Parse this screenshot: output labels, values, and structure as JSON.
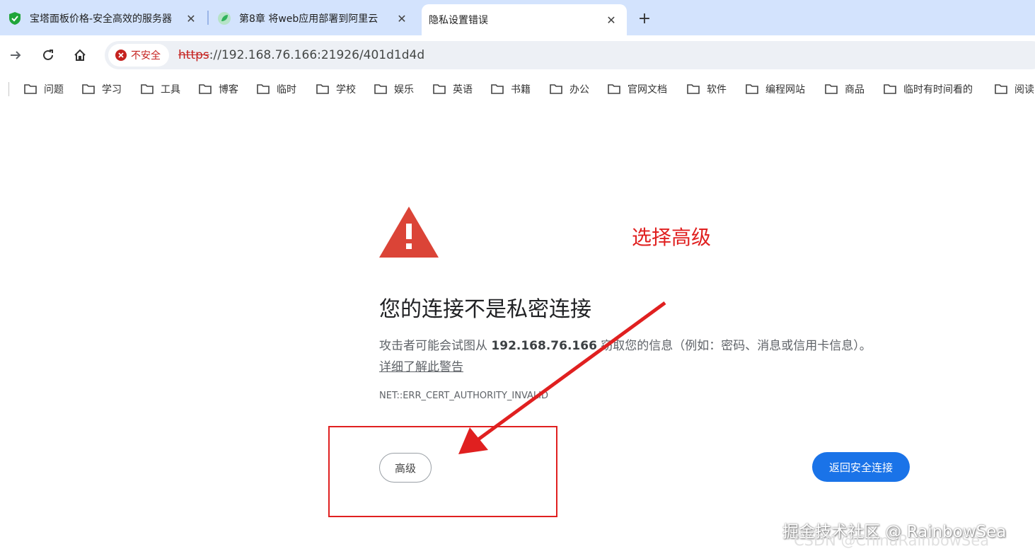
{
  "tabs": [
    {
      "title": "宝塔面板价格-安全高效的服务器",
      "favicon": "baota-shield-icon",
      "active": false
    },
    {
      "title": "第8章 将web应用部署到阿里云",
      "favicon": "juejin-leaf-icon",
      "active": false
    },
    {
      "title": "隐私设置错误",
      "favicon": "",
      "active": true
    }
  ],
  "toolbar": {
    "security_label": "不安全",
    "url_scheme": "https",
    "url_rest": "://192.168.76.166:21926/401d1d4d"
  },
  "bookmarks": [
    "问题",
    "学习",
    "工具",
    "博客",
    "临时",
    "学校",
    "娱乐",
    "英语",
    "书籍",
    "办公",
    "官网文档",
    "软件",
    "编程网站",
    "商品",
    "临时有时间看的",
    "阅读"
  ],
  "page": {
    "heading": "您的连接不是私密连接",
    "desc_before": "攻击者可能会试图从 ",
    "desc_host": "192.168.76.166",
    "desc_after": " 窃取您的信息（例如：密码、消息或信用卡信息）。",
    "learn_more": "详细了解此警告",
    "error_code": "NET::ERR_CERT_AUTHORITY_INVALID",
    "advanced_button": "高级",
    "back_button": "返回安全连接"
  },
  "annotation": {
    "text": "选择高级",
    "color": "#e02020"
  },
  "watermark": {
    "line1": "掘金技术社区 @ RainbowSea",
    "line2": "CSDN @ChinaRainbowSea"
  },
  "colors": {
    "tabstrip": "#d3e3fd",
    "danger": "#c5221f",
    "primary": "#1a73e8",
    "warning_triangle": "#db4437"
  }
}
